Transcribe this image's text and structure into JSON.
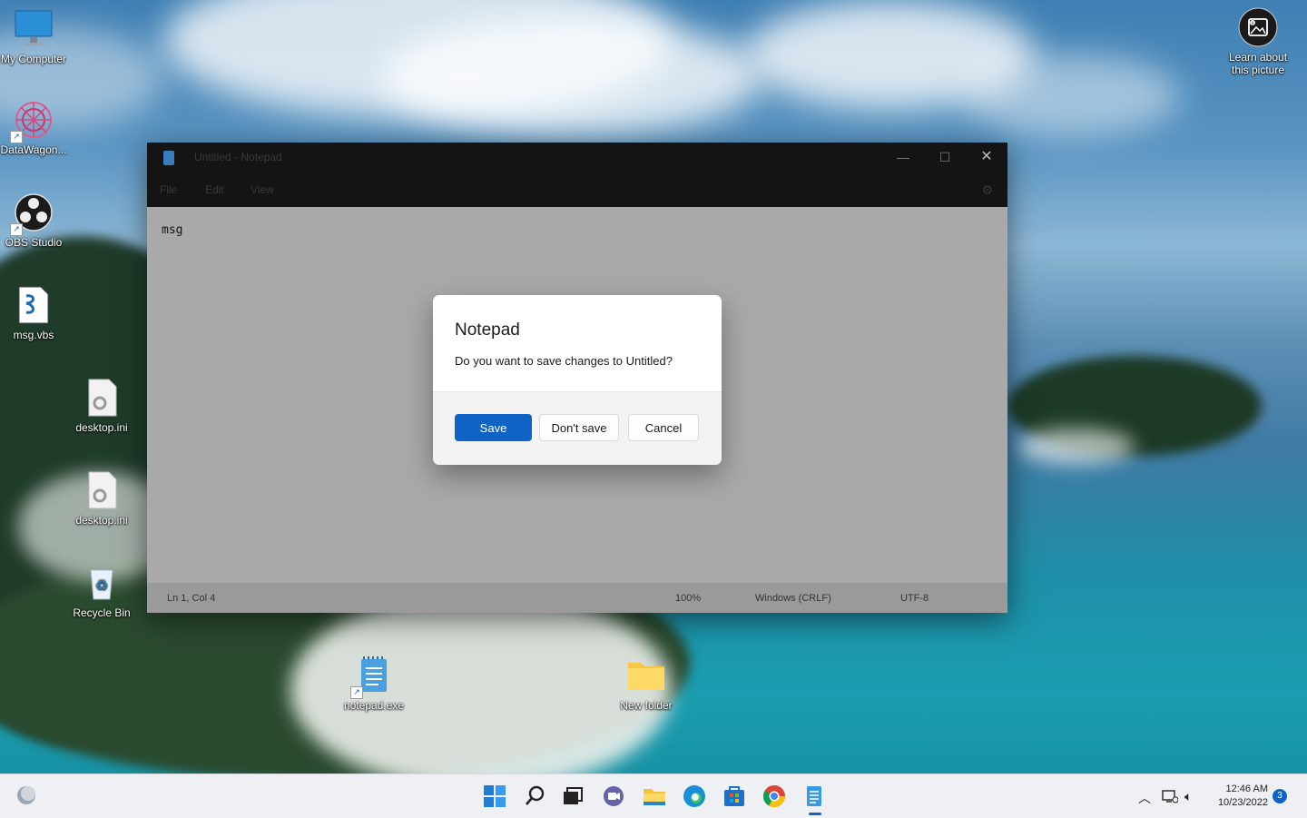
{
  "desktop": {
    "icons": [
      {
        "label": "My Computer"
      },
      {
        "label": "DataWagon..."
      },
      {
        "label": "OBS Studio"
      },
      {
        "label": "msg.vbs"
      },
      {
        "label": "desktop.ini"
      },
      {
        "label": "desktop.ini"
      },
      {
        "label": "Recycle Bin"
      },
      {
        "label": "notepad.exe"
      },
      {
        "label": "New folder"
      }
    ],
    "learn_about": "Learn about this picture"
  },
  "notepad": {
    "title": "Untitled - Notepad",
    "menus": [
      "File",
      "Edit",
      "View"
    ],
    "content": "msg",
    "status": {
      "position": "Ln 1, Col 4",
      "zoom": "100%",
      "line_ending": "Windows (CRLF)",
      "encoding": "UTF-8"
    }
  },
  "dialog": {
    "title": "Notepad",
    "message": "Do you want to save changes to Untitled?",
    "save": "Save",
    "dont_save": "Don't save",
    "cancel": "Cancel"
  },
  "taskbar": {
    "time": "12:46 AM",
    "date": "10/23/2022",
    "notification_count": "3"
  },
  "colors": {
    "accent": "#0f63c4",
    "titlebar": "#141414",
    "editor_dimmed": "#a9a9a9"
  }
}
